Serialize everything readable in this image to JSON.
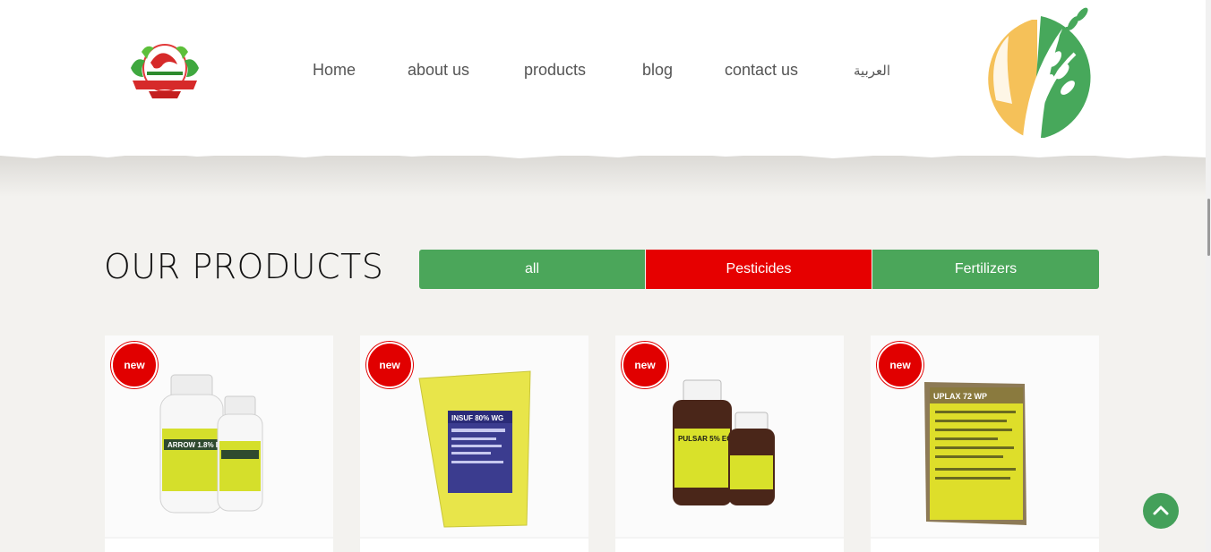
{
  "header": {
    "nav": [
      {
        "label": "Home"
      },
      {
        "label": "about us"
      },
      {
        "label": "products"
      },
      {
        "label": "blog"
      },
      {
        "label": "contact us"
      },
      {
        "label": "العربية"
      }
    ]
  },
  "products_section": {
    "title": "OUR PRODUCTS",
    "filters": [
      {
        "label": "all",
        "color": "#4ba65a"
      },
      {
        "label": "Pesticides",
        "color": "#e60000"
      },
      {
        "label": "Fertilizers",
        "color": "#4ba65a"
      }
    ],
    "products": [
      {
        "badge": "new",
        "label_text": "ARROW 1.8% EC"
      },
      {
        "badge": "new",
        "label_text": "INSUF 80% WG"
      },
      {
        "badge": "new",
        "label_text": "PULSAR 5% EC"
      },
      {
        "badge": "new",
        "label_text": "UPLAX 72 WP"
      }
    ]
  },
  "colors": {
    "brand_green": "#44a05a",
    "brand_red": "#e60000",
    "background": "#f3f2ef"
  },
  "icons": {
    "back_to_top": "chevron-up-icon"
  }
}
